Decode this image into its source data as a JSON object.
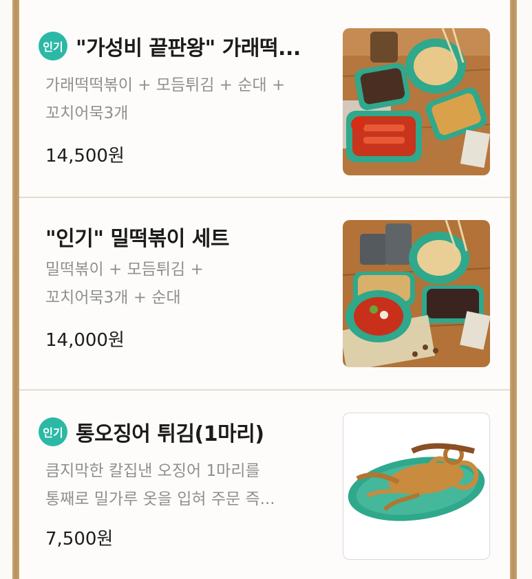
{
  "menu_items": [
    {
      "badge": "인기",
      "title": "\"가성비 끝판왕\" 가래떡...",
      "desc_line1": "가래떡떡볶이 + 모듬튀김 + 순대 +",
      "desc_line2": "꼬치어묵3개",
      "price": "14,500원"
    },
    {
      "badge": "",
      "title": "\"인기\" 밀떡볶이 세트",
      "desc_line1": "밀떡볶이 + 모듬튀김 +",
      "desc_line2": "꼬치어묵3개 + 순대",
      "price": "14,000원"
    },
    {
      "badge": "인기",
      "title": "통오징어 튀김(1마리)",
      "desc_line1": "큼지막한 칼집낸 오징어 1마리를",
      "desc_line2": "통째로 밀가루 옷을 입혀 주문 즉...",
      "price": "7,500원"
    }
  ],
  "colors": {
    "badge": "#2bb9a6",
    "frame": "#c9a36f",
    "divider": "#e6dccd"
  }
}
